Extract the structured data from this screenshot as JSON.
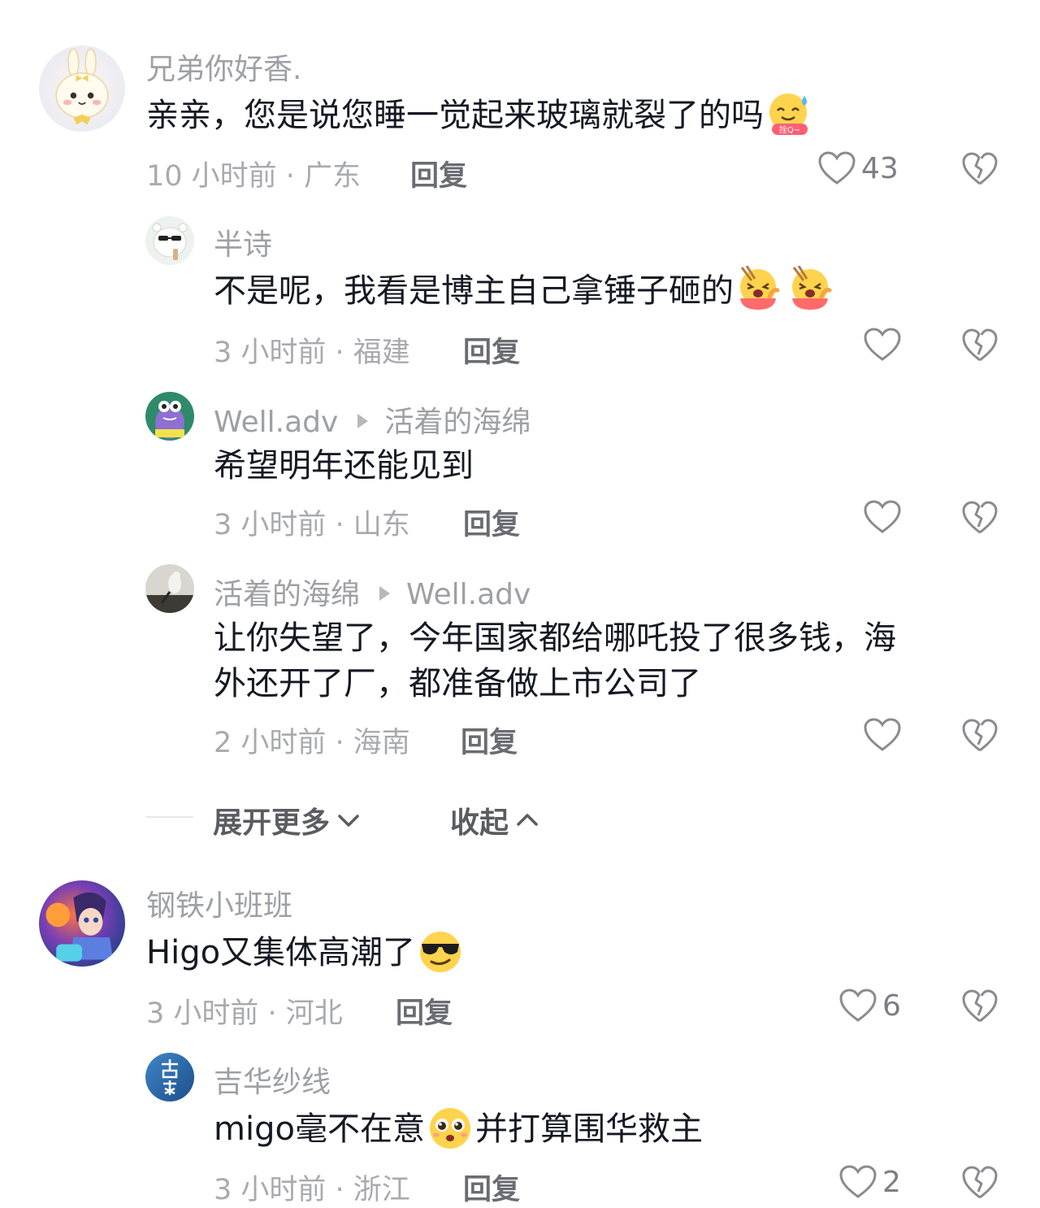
{
  "comments": [
    {
      "name": "兄弟你好香.",
      "text": "亲亲，您是说您睡一觉起来玻璃就裂了的吗",
      "emoji_text": "拴Q~",
      "time": "10 小时前 · 广东",
      "reply": "回复",
      "likes": "43"
    },
    {
      "name": "半诗",
      "text": "不是呢，我看是博主自己拿锤子砸的",
      "time": "3 小时前 · 福建",
      "reply": "回复",
      "likes": ""
    },
    {
      "name": "Well.adv",
      "reply_to": "活着的海绵",
      "text": "希望明年还能见到",
      "time": "3 小时前 · 山东",
      "reply": "回复",
      "likes": ""
    },
    {
      "name": "活着的海绵",
      "reply_to": "Well.adv",
      "text_line1": "让你失望了，今年国家都给哪吒投了很多钱，海",
      "text_line2": "外还开了厂，都准备做上市公司了",
      "time": "2 小时前 · 海南",
      "reply": "回复",
      "likes": ""
    },
    {
      "name": "钢铁小班班",
      "text": "Higo又集体高潮了",
      "time": "3 小时前 · 河北",
      "reply": "回复",
      "likes": "6"
    },
    {
      "name": "吉华纱线",
      "text_before": "migo毫不在意",
      "text_after": "并打算围华救主",
      "time": "3 小时前 · 浙江",
      "reply": "回复",
      "likes": "2"
    }
  ],
  "thread_controls": {
    "expand_more": "展开更多",
    "collapse": "收起"
  },
  "colors": {
    "text": "#161823",
    "meta": "#a9aab0",
    "name": "#9fa0a6"
  },
  "icons": [
    "heart-outline-icon",
    "broken-heart-icon",
    "chevron-down-icon",
    "chevron-up-icon",
    "reply-arrow-icon"
  ]
}
